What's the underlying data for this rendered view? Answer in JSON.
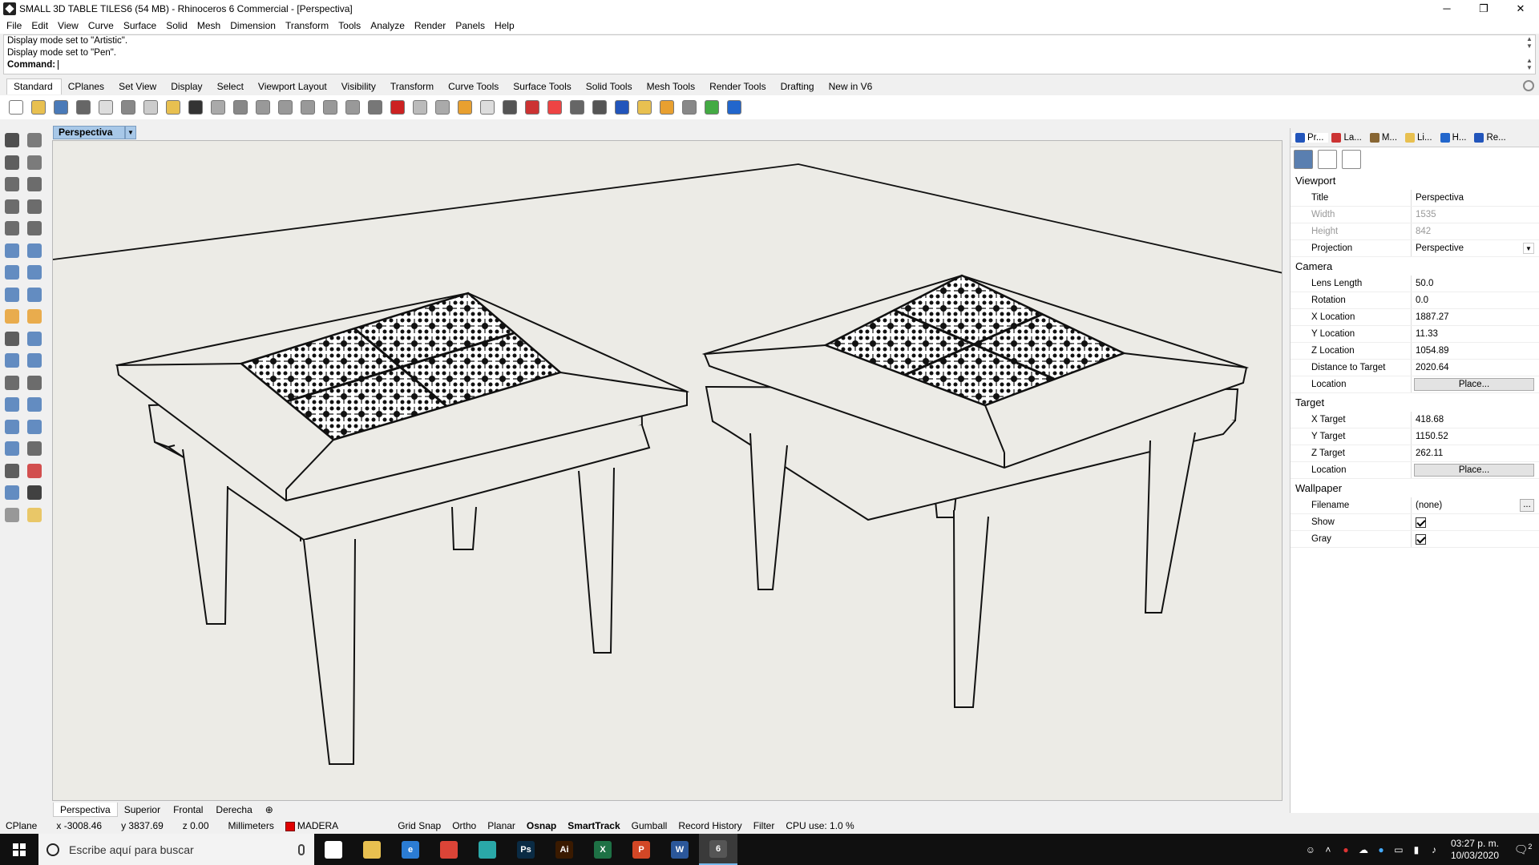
{
  "window": {
    "title": "SMALL 3D TABLE TILES6 (54 MB) - Rhinoceros 6 Commercial - [Perspectiva]",
    "minimize": "─",
    "maximize": "❐",
    "close": "✕"
  },
  "menu": [
    "File",
    "Edit",
    "View",
    "Curve",
    "Surface",
    "Solid",
    "Mesh",
    "Dimension",
    "Transform",
    "Tools",
    "Analyze",
    "Render",
    "Panels",
    "Help"
  ],
  "command": {
    "history": [
      "Display mode set to \"Artistic\".",
      "Display mode set to \"Pen\"."
    ],
    "prompt": "Command:"
  },
  "toolbar_tabs": [
    "Standard",
    "CPlanes",
    "Set View",
    "Display",
    "Select",
    "Viewport Layout",
    "Visibility",
    "Transform",
    "Curve Tools",
    "Surface Tools",
    "Solid Tools",
    "Mesh Tools",
    "Render Tools",
    "Drafting",
    "New in V6"
  ],
  "toolbar_icons": [
    {
      "name": "new-icon",
      "color": "#ffffff"
    },
    {
      "name": "open-icon",
      "color": "#e8c050"
    },
    {
      "name": "save-icon",
      "color": "#4a7ab8"
    },
    {
      "name": "print-icon",
      "color": "#666666"
    },
    {
      "name": "import-icon",
      "color": "#dddddd"
    },
    {
      "name": "cut-icon",
      "color": "#888888"
    },
    {
      "name": "copy-icon",
      "color": "#cccccc"
    },
    {
      "name": "paste-icon",
      "color": "#e8c050"
    },
    {
      "name": "undo-icon",
      "color": "#333333"
    },
    {
      "name": "pan-icon",
      "color": "#aaaaaa"
    },
    {
      "name": "rotate-view-icon",
      "color": "#888888"
    },
    {
      "name": "zoom-dynamic-icon",
      "color": "#999999"
    },
    {
      "name": "zoom-window-icon",
      "color": "#999999"
    },
    {
      "name": "zoom-extents-icon",
      "color": "#999999"
    },
    {
      "name": "zoom-selected-icon",
      "color": "#999999"
    },
    {
      "name": "undo-view-icon",
      "color": "#999999"
    },
    {
      "name": "four-viewports-icon",
      "color": "#777777"
    },
    {
      "name": "car-icon",
      "color": "#cc2222"
    },
    {
      "name": "jet-icon",
      "color": "#bbbbbb"
    },
    {
      "name": "cplane-icon",
      "color": "#aaaaaa"
    },
    {
      "name": "osnap-icon",
      "color": "#e8a030"
    },
    {
      "name": "light-bulb-icon",
      "color": "#dddddd"
    },
    {
      "name": "lock-icon",
      "color": "#555555"
    },
    {
      "name": "layer-icon",
      "color": "#cc3333"
    },
    {
      "name": "color-wheel-icon",
      "color": "#ee4444"
    },
    {
      "name": "shaded-icon",
      "color": "#666666"
    },
    {
      "name": "rendered-icon",
      "color": "#555555"
    },
    {
      "name": "render-sphere-icon",
      "color": "#2255bb"
    },
    {
      "name": "flashlight-icon",
      "color": "#e8c050"
    },
    {
      "name": "options-icon",
      "color": "#e8a030"
    },
    {
      "name": "dimension-icon",
      "color": "#888888"
    },
    {
      "name": "globe-icon",
      "color": "#44aa44"
    },
    {
      "name": "help-icon",
      "color": "#2266cc"
    }
  ],
  "left_tools": [
    {
      "name": "select-arrow-icon",
      "color": "#333333"
    },
    {
      "name": "point-icon",
      "color": "#666666"
    },
    {
      "name": "polyline-icon",
      "color": "#444444"
    },
    {
      "name": "control-point-curve-icon",
      "color": "#666666"
    },
    {
      "name": "circle-icon",
      "color": "#555555"
    },
    {
      "name": "ellipse-icon",
      "color": "#555555"
    },
    {
      "name": "arc-icon",
      "color": "#555555"
    },
    {
      "name": "rectangle-icon",
      "color": "#555555"
    },
    {
      "name": "polygon-icon",
      "color": "#555555"
    },
    {
      "name": "fillet-curve-icon",
      "color": "#555555"
    },
    {
      "name": "extrude-curve-icon",
      "color": "#4a7ab8"
    },
    {
      "name": "surface-icon",
      "color": "#4a7ab8"
    },
    {
      "name": "box-icon",
      "color": "#4a7ab8"
    },
    {
      "name": "sphere-icon",
      "color": "#4a7ab8"
    },
    {
      "name": "cylinder-icon",
      "color": "#4a7ab8"
    },
    {
      "name": "mesh-icon",
      "color": "#4a7ab8"
    },
    {
      "name": "boolean-icon",
      "color": "#e8a030"
    },
    {
      "name": "explode-icon",
      "color": "#e8a030"
    },
    {
      "name": "trim-icon",
      "color": "#444444"
    },
    {
      "name": "split-icon",
      "color": "#4a7ab8"
    },
    {
      "name": "join-icon",
      "color": "#4a7ab8"
    },
    {
      "name": "group-icon",
      "color": "#4a7ab8"
    },
    {
      "name": "offset-icon",
      "color": "#555555"
    },
    {
      "name": "fillet-edge-icon",
      "color": "#555555"
    },
    {
      "name": "text-icon",
      "color": "#4a7ab8"
    },
    {
      "name": "scale-icon",
      "color": "#4a7ab8"
    },
    {
      "name": "array-icon",
      "color": "#4a7ab8"
    },
    {
      "name": "mirror-icon",
      "color": "#4a7ab8"
    },
    {
      "name": "dimension-tool-icon",
      "color": "#4a7ab8"
    },
    {
      "name": "measure-icon",
      "color": "#555555"
    },
    {
      "name": "grid-array-icon",
      "color": "#444444"
    },
    {
      "name": "history-icon",
      "color": "#cc3333"
    },
    {
      "name": "analyze-icon",
      "color": "#4a7ab8"
    },
    {
      "name": "check-icon",
      "color": "#222222"
    },
    {
      "name": "render-tool-icon",
      "color": "#888888"
    },
    {
      "name": "warning-icon",
      "color": "#e8c050"
    }
  ],
  "viewport": {
    "name": "Perspectiva",
    "dropdown": "▼",
    "tabs": [
      "Perspectiva",
      "Superior",
      "Frontal",
      "Derecha"
    ],
    "add_tab": "⊕"
  },
  "panel": {
    "tabs": [
      {
        "label": "Pr...",
        "icon": "properties-icon",
        "color": "#2255bb"
      },
      {
        "label": "La...",
        "icon": "layers-icon",
        "color": "#cc3333"
      },
      {
        "label": "M...",
        "icon": "materials-icon",
        "color": "#886633"
      },
      {
        "label": "Li...",
        "icon": "libraries-icon",
        "color": "#e8c050"
      },
      {
        "label": "H...",
        "icon": "help-panel-icon",
        "color": "#2266cc"
      },
      {
        "label": "Re...",
        "icon": "rendering-icon",
        "color": "#2255bb"
      }
    ],
    "sections": {
      "viewport": "Viewport",
      "camera": "Camera",
      "target": "Target",
      "wallpaper": "Wallpaper"
    },
    "viewport_rows": {
      "title_k": "Title",
      "title_v": "Perspectiva",
      "width_k": "Width",
      "width_v": "1535",
      "height_k": "Height",
      "height_v": "842",
      "projection_k": "Projection",
      "projection_v": "Perspective"
    },
    "camera_rows": {
      "lens_k": "Lens Length",
      "lens_v": "50.0",
      "rot_k": "Rotation",
      "rot_v": "0.0",
      "x_k": "X Location",
      "x_v": "1887.27",
      "y_k": "Y Location",
      "y_v": "11.33",
      "z_k": "Z Location",
      "z_v": "1054.89",
      "dist_k": "Distance to Target",
      "dist_v": "2020.64",
      "loc_k": "Location",
      "loc_btn": "Place..."
    },
    "target_rows": {
      "x_k": "X Target",
      "x_v": "418.68",
      "y_k": "Y Target",
      "y_v": "1150.52",
      "z_k": "Z Target",
      "z_v": "262.11",
      "loc_k": "Location",
      "loc_btn": "Place..."
    },
    "wallpaper_rows": {
      "file_k": "Filename",
      "file_v": "(none)",
      "file_btn": "...",
      "show_k": "Show",
      "show_checked": true,
      "gray_k": "Gray",
      "gray_checked": true
    }
  },
  "status": {
    "cplane": "CPlane",
    "x": "x -3008.46",
    "y": "y 3837.69",
    "z": "z 0.00",
    "units": "Millimeters",
    "layer": "MADERA",
    "layer_color": "#e00000",
    "toggles": [
      {
        "label": "Grid Snap",
        "on": false
      },
      {
        "label": "Ortho",
        "on": false
      },
      {
        "label": "Planar",
        "on": false
      },
      {
        "label": "Osnap",
        "on": true
      },
      {
        "label": "SmartTrack",
        "on": true
      },
      {
        "label": "Gumball",
        "on": false
      },
      {
        "label": "Record History",
        "on": false
      },
      {
        "label": "Filter",
        "on": false
      }
    ],
    "cpu": "CPU use: 1.0 %"
  },
  "taskbar": {
    "search_placeholder": "Escribe aquí para buscar",
    "apps": [
      {
        "name": "task-view-icon",
        "label": "",
        "color": "#ffffff"
      },
      {
        "name": "file-explorer-icon",
        "label": "",
        "color": "#e8c050"
      },
      {
        "name": "edge-icon",
        "label": "e",
        "color": "#2b7cd3"
      },
      {
        "name": "chrome-icon",
        "label": "",
        "color": "#db4437"
      },
      {
        "name": "app-icon",
        "label": "",
        "color": "#2aa8a8"
      },
      {
        "name": "photoshop-icon",
        "label": "Ps",
        "color": "#0a2b44"
      },
      {
        "name": "illustrator-icon",
        "label": "Ai",
        "color": "#3a1a00"
      },
      {
        "name": "excel-icon",
        "label": "X",
        "color": "#1e7145"
      },
      {
        "name": "powerpoint-icon",
        "label": "P",
        "color": "#d24726"
      },
      {
        "name": "word-icon",
        "label": "W",
        "color": "#2b579a"
      },
      {
        "name": "rhino-icon",
        "label": "6",
        "color": "#555555"
      }
    ],
    "time": "03:27 p. m.",
    "date": "10/03/2020",
    "notifications": "2"
  }
}
